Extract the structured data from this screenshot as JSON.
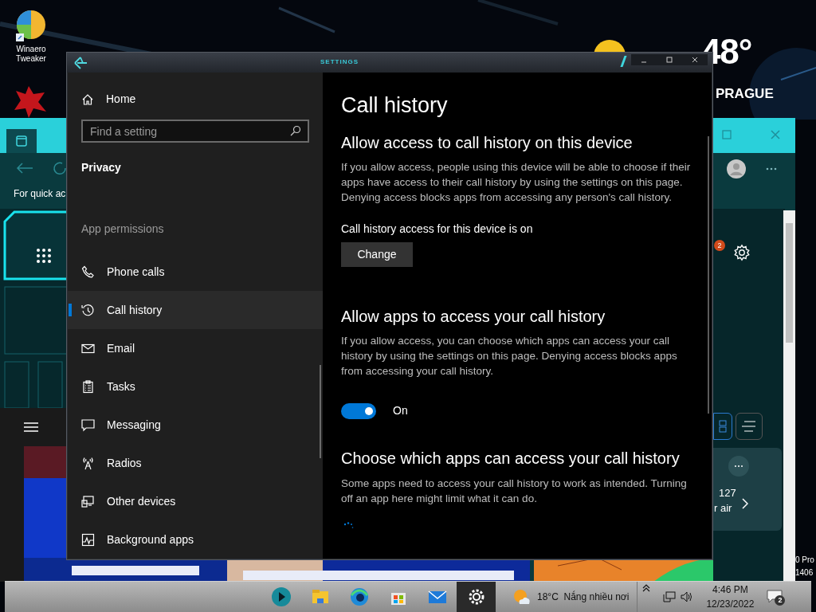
{
  "desktop_icons": [
    {
      "label": "Winaero Tweaker"
    }
  ],
  "weather_widget": {
    "temperature": "48°",
    "city": "PRAGUE"
  },
  "background_window": {
    "info_text": "For quick ac",
    "notification_count": "2",
    "card_value": "127",
    "card_text": "r air"
  },
  "watermark_lines": [
    "0 Pro",
    "1406"
  ],
  "settings_window": {
    "title": "SETTINGS",
    "sidebar": {
      "home": "Home",
      "search": {
        "placeholder": "Find a setting"
      },
      "section": "Privacy",
      "group": "App permissions",
      "items": [
        {
          "label": "Phone calls",
          "selected": false
        },
        {
          "label": "Call history",
          "selected": true
        },
        {
          "label": "Email",
          "selected": false
        },
        {
          "label": "Tasks",
          "selected": false
        },
        {
          "label": "Messaging",
          "selected": false
        },
        {
          "label": "Radios",
          "selected": false
        },
        {
          "label": "Other devices",
          "selected": false
        },
        {
          "label": "Background apps",
          "selected": false
        }
      ]
    },
    "page_title": "Call history",
    "device_section": {
      "heading": "Allow access to call history on this device",
      "description": "If you allow access, people using this device will be able to choose if their apps have access to their call history by using the settings on this page. Denying access blocks apps from accessing any person's call history.",
      "status": "Call history access for this device is on",
      "button": "Change"
    },
    "apps_section": {
      "heading": "Allow apps to access your call history",
      "description": "If you allow access, you can choose which apps can access your call history by using the settings on this page. Denying access blocks apps from accessing your call history.",
      "toggle": {
        "on": true,
        "label": "On"
      }
    },
    "choose_section": {
      "heading": "Choose which apps can access your call history",
      "description": "Some apps need to access your call history to work as intended. Turning off an app here might limit what it can do."
    }
  },
  "taskbar": {
    "apps": [
      {
        "selected": false
      },
      {
        "selected": false
      },
      {
        "selected": false
      },
      {
        "selected": false
      },
      {
        "selected": false
      },
      {
        "selected": true
      }
    ],
    "weather": "18°C  Nắng nhiều nơi",
    "time": "4:46 PM",
    "date": "12/23/2022",
    "notification_count": "2"
  }
}
